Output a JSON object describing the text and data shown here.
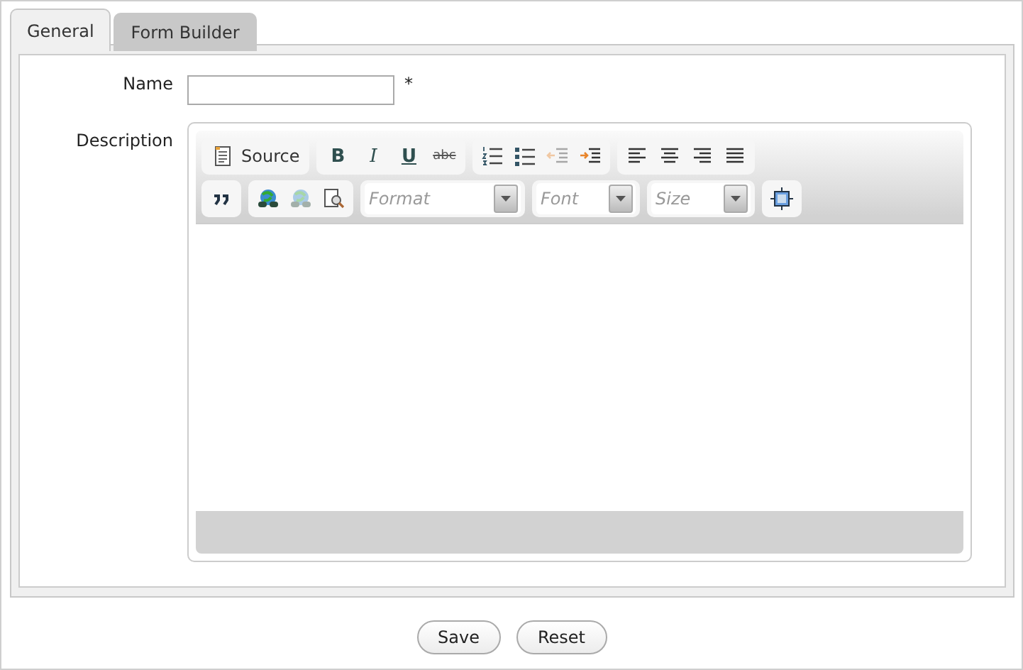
{
  "tabs": [
    {
      "label": "General",
      "selected": true
    },
    {
      "label": "Form Builder",
      "selected": false
    }
  ],
  "fields": [
    {
      "kind": "text",
      "label": "Name",
      "required": "*"
    },
    {
      "kind": "editor",
      "label": "Description"
    }
  ],
  "editor": {
    "toolbar_rows": [
      [
        [
          {
            "kind": "source",
            "label": "Source"
          }
        ],
        [
          {
            "kind": "bold",
            "label": "B"
          },
          {
            "kind": "italic",
            "label": "I"
          },
          {
            "kind": "underline",
            "label": "U"
          },
          {
            "kind": "strike",
            "label": "abc"
          }
        ],
        [
          {
            "kind": "numbered",
            "disabled": false
          },
          {
            "kind": "bulleted",
            "disabled": false
          },
          {
            "kind": "outdent",
            "disabled": true
          },
          {
            "kind": "indent",
            "disabled": false
          }
        ],
        [
          {
            "kind": "left",
            "disabled": false
          },
          {
            "kind": "center",
            "disabled": false
          },
          {
            "kind": "right",
            "disabled": false
          },
          {
            "kind": "justify",
            "disabled": false
          }
        ]
      ],
      [
        [
          {
            "kind": "quote",
            "disabled": false
          }
        ],
        [
          {
            "kind": "link",
            "disabled": false
          },
          {
            "kind": "link",
            "disabled": true
          },
          {
            "kind": "image",
            "disabled": false
          }
        ],
        [
          {
            "kind": "combo",
            "placeholder": "Format"
          }
        ],
        [
          {
            "kind": "combo",
            "placeholder": "Font"
          }
        ],
        [
          {
            "kind": "combo",
            "placeholder": "Size"
          }
        ],
        [
          {
            "kind": "maximize",
            "disabled": false
          }
        ]
      ]
    ]
  },
  "buttons": [
    "Save",
    "Reset"
  ]
}
